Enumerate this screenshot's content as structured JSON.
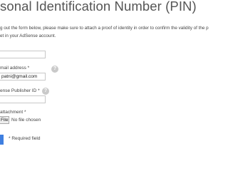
{
  "page": {
    "title": "sonal Identification Number (PIN)",
    "intro_lines": [
      "g out the form below, please make sure to attach a proof of identity in order to confirm the validity of the p",
      "et in your AdSense account."
    ]
  },
  "form": {
    "name_field": {
      "value": ""
    },
    "email": {
      "label": "mail address *",
      "value": "patni@gmail.com",
      "help_icon": "?"
    },
    "publisher_id": {
      "label": "ense Publisher ID *",
      "value": "",
      "help_icon": "?"
    },
    "attachment": {
      "label": "attachment *",
      "button_label": "File",
      "status": "No file chosen"
    },
    "required_note": "* Required field"
  },
  "colors": {
    "submit_accent": "#3f7fe0",
    "help_icon_bg": "#c9c9c9"
  }
}
